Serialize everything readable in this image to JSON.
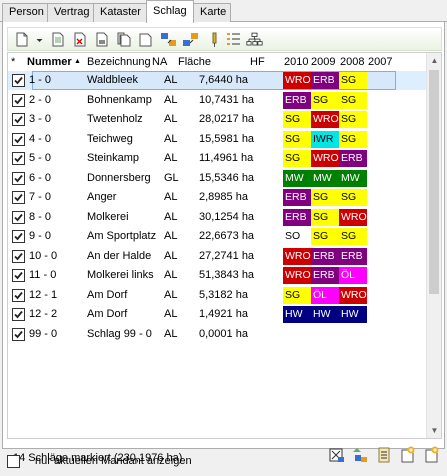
{
  "tabs": [
    {
      "label": "Person",
      "active": false
    },
    {
      "label": "Vertrag",
      "active": false
    },
    {
      "label": "Kataster",
      "active": false
    },
    {
      "label": "Schlag",
      "active": true
    },
    {
      "label": "Karte",
      "active": false
    }
  ],
  "toolbar": {
    "buttons": [
      "new-icon",
      "dropdown-arrow-icon",
      "edit-icon",
      "delete-icon",
      "print-icon",
      "copy-icon",
      "export-icon",
      "import-icon",
      "merge-icon",
      "tool-icon",
      "list-icon",
      "tree-icon"
    ]
  },
  "columns": {
    "check": "*",
    "nummer": "Nummer",
    "bezeichnung": "Bezeichnung",
    "na": "NA",
    "flaeche": "Fläche",
    "hf": "HF",
    "y2010": "2010",
    "y2009": "2009",
    "y2008": "2008",
    "y2007": "2007"
  },
  "crop_colors": {
    "WRO": {
      "bg": "#cc0000",
      "fg": "#ffffff"
    },
    "ERB": {
      "bg": "#800080",
      "fg": "#ffffff"
    },
    "SG": {
      "bg": "#ffff00",
      "fg": "#000000"
    },
    "MW": {
      "bg": "#008000",
      "fg": "#ffffff"
    },
    "IWR": {
      "bg": "#00e5e5",
      "fg": "#000000"
    },
    "ÖL": {
      "bg": "#ff00ff",
      "fg": "#ffffff"
    },
    "HW": {
      "bg": "#000080",
      "fg": "#ffffff"
    },
    "SO": {
      "bg": "#ffffff",
      "fg": "#000000"
    }
  },
  "rows": [
    {
      "nummer": "1 - 0",
      "bezeichnung": "Waldbleek",
      "na": "AL",
      "flaeche": "7,6440 ha",
      "crops": [
        "WRO",
        "ERB",
        "SG"
      ],
      "selected": true
    },
    {
      "nummer": "2 - 0",
      "bezeichnung": "Bohnenkamp",
      "na": "AL",
      "flaeche": "10,7431 ha",
      "crops": [
        "ERB",
        "SG",
        "SG"
      ]
    },
    {
      "nummer": "3 - 0",
      "bezeichnung": "Twetenholz",
      "na": "AL",
      "flaeche": "28,0217 ha",
      "crops": [
        "SG",
        "WRO",
        "SG"
      ]
    },
    {
      "nummer": "4 - 0",
      "bezeichnung": "Teichweg",
      "na": "AL",
      "flaeche": "15,5981 ha",
      "crops": [
        "SG",
        "IWR",
        "SG"
      ]
    },
    {
      "nummer": "5 - 0",
      "bezeichnung": "Steinkamp",
      "na": "AL",
      "flaeche": "11,4961 ha",
      "crops": [
        "SG",
        "WRO",
        "ERB"
      ]
    },
    {
      "nummer": "6 - 0",
      "bezeichnung": "Donnersberg",
      "na": "GL",
      "flaeche": "15,5346 ha",
      "crops": [
        "MW",
        "MW",
        "MW"
      ]
    },
    {
      "nummer": "7 - 0",
      "bezeichnung": "Anger",
      "na": "AL",
      "flaeche": "2,8985 ha",
      "crops": [
        "ERB",
        "SG",
        "SG"
      ]
    },
    {
      "nummer": "8 - 0",
      "bezeichnung": "Molkerei",
      "na": "AL",
      "flaeche": "30,1254 ha",
      "crops": [
        "ERB",
        "SG",
        "WRO"
      ]
    },
    {
      "nummer": "9 - 0",
      "bezeichnung": "Am Sportplatz",
      "na": "AL",
      "flaeche": "22,6673 ha",
      "crops": [
        "SO",
        "SG",
        "SG"
      ]
    },
    {
      "nummer": "10 - 0",
      "bezeichnung": "An der Halde",
      "na": "AL",
      "flaeche": "27,2741 ha",
      "crops": [
        "WRO",
        "ERB",
        "ERB"
      ]
    },
    {
      "nummer": "11 - 0",
      "bezeichnung": "Molkerei links",
      "na": "AL",
      "flaeche": "51,3843 ha",
      "crops": [
        "WRO",
        "ERB",
        "ÖL"
      ]
    },
    {
      "nummer": "12 - 1",
      "bezeichnung": "Am Dorf",
      "na": "AL",
      "flaeche": "5,3182 ha",
      "crops": [
        "SG",
        "ÖL",
        "WRO"
      ]
    },
    {
      "nummer": "12 - 2",
      "bezeichnung": "Am Dorf",
      "na": "AL",
      "flaeche": "1,4921 ha",
      "crops": [
        "HW",
        "HW",
        "HW"
      ]
    },
    {
      "nummer": "99 - 0",
      "bezeichnung": "Schlag 99 - 0",
      "na": "AL",
      "flaeche": "0,0001 ha",
      "crops": []
    }
  ],
  "status": {
    "text": "14 Schläge markiert (230,1976 ha)",
    "buttons": [
      "map-select-icon",
      "copy-schlag-icon",
      "document-icon",
      "add-icon",
      "add-copy-icon"
    ]
  },
  "bottom_checkbox": {
    "label": "nur aktuellen Mandant anzeigen",
    "checked": false
  }
}
